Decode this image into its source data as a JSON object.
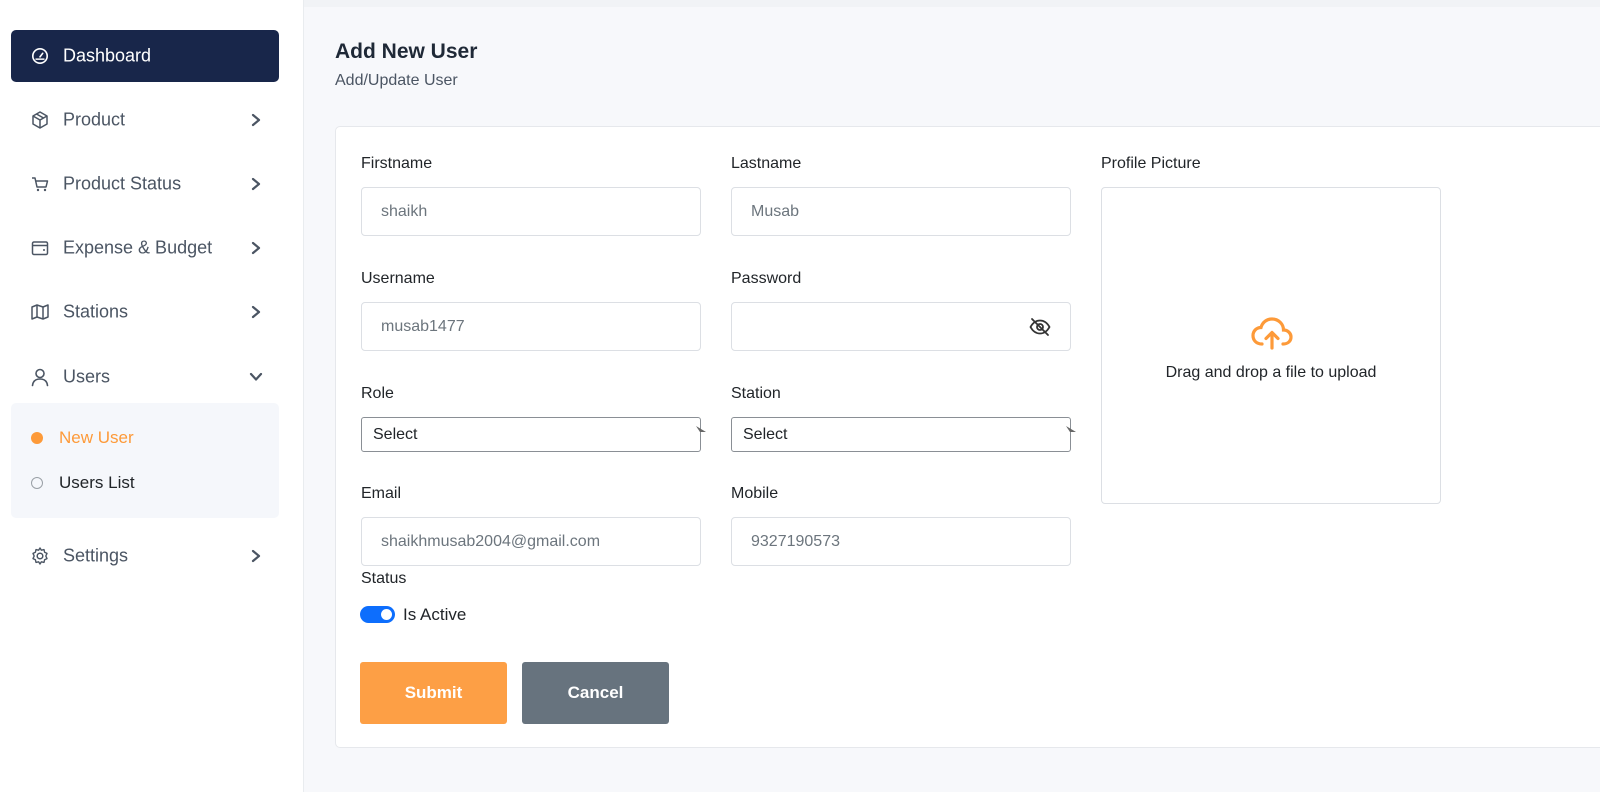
{
  "sidebar": {
    "items": [
      {
        "label": "Dashboard",
        "icon": "gauge-icon",
        "active": true
      },
      {
        "label": "Product",
        "icon": "box-icon"
      },
      {
        "label": "Product Status",
        "icon": "cart-icon"
      },
      {
        "label": "Expense & Budget",
        "icon": "wallet-icon"
      },
      {
        "label": "Stations",
        "icon": "map-icon"
      },
      {
        "label": "Users",
        "icon": "user-icon",
        "expanded": true
      },
      {
        "label": "Settings",
        "icon": "gear-icon"
      }
    ],
    "users_submenu": [
      {
        "label": "New User",
        "active": true
      },
      {
        "label": "Users List"
      }
    ]
  },
  "header": {
    "title": "Add New User",
    "subtitle": "Add/Update User"
  },
  "form": {
    "firstname": {
      "label": "Firstname",
      "value": "shaikh"
    },
    "lastname": {
      "label": "Lastname",
      "value": "Musab"
    },
    "username": {
      "label": "Username",
      "value": "musab1477"
    },
    "password": {
      "label": "Password",
      "value": ""
    },
    "role": {
      "label": "Role",
      "selected": "Select"
    },
    "station": {
      "label": "Station",
      "selected": "Select"
    },
    "email": {
      "label": "Email",
      "value": "shaikhmusab2004@gmail.com"
    },
    "mobile": {
      "label": "Mobile",
      "value": "9327190573"
    },
    "profile_picture": {
      "label": "Profile Picture",
      "dropzone_text": "Drag and drop a file to upload"
    },
    "status": {
      "label": "Status",
      "toggle_label": "Is Active",
      "active": true
    },
    "submit_label": "Submit",
    "cancel_label": "Cancel"
  },
  "colors": {
    "sidebar_active_bg": "#18264a",
    "accent_orange": "#fd9f45",
    "cancel_gray": "#67737e",
    "toggle_blue": "#0d6efd"
  }
}
